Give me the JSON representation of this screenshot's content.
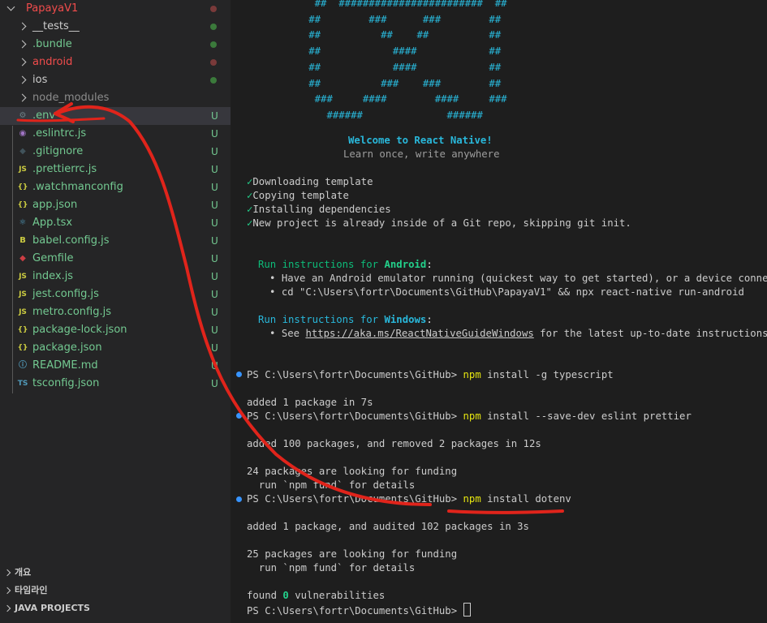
{
  "explorer": {
    "root": {
      "label": "PapayaV1",
      "color": "#f14c4c",
      "dot": "#7a3a3a"
    },
    "folders": [
      {
        "label": "__tests__",
        "color": "#cccccc",
        "dot": "#3b7a3b"
      },
      {
        "label": ".bundle",
        "color": "#73c991",
        "dot": "#3b7a3b"
      },
      {
        "label": "android",
        "color": "#f14c4c",
        "dot": "#7a3a3a"
      },
      {
        "label": "ios",
        "color": "#cccccc",
        "dot": "#3b7a3b"
      },
      {
        "label": "node_modules",
        "color": "#8c8c8c",
        "dot": ""
      }
    ],
    "files": [
      {
        "label": ".env",
        "icon": "gear-icon",
        "glyph": "⚙",
        "icon_color": "#6d8086",
        "status": "U",
        "selected": true
      },
      {
        "label": ".eslintrc.js",
        "icon": "eslint-icon",
        "glyph": "◉",
        "icon_color": "#a074c4",
        "status": "U"
      },
      {
        "label": ".gitignore",
        "icon": "git-icon",
        "glyph": "◆",
        "icon_color": "#41535b",
        "status": "U"
      },
      {
        "label": ".prettierrc.js",
        "icon": "js-icon",
        "glyph": "JS",
        "icon_color": "#cbcb41",
        "status": "U"
      },
      {
        "label": ".watchmanconfig",
        "icon": "json-icon",
        "glyph": "{}",
        "icon_color": "#cbcb41",
        "status": "U"
      },
      {
        "label": "app.json",
        "icon": "json-icon",
        "glyph": "{}",
        "icon_color": "#cbcb41",
        "status": "U"
      },
      {
        "label": "App.tsx",
        "icon": "react-icon",
        "glyph": "⚛",
        "icon_color": "#519aba",
        "status": "U"
      },
      {
        "label": "babel.config.js",
        "icon": "babel-icon",
        "glyph": "B",
        "icon_color": "#cbcb41",
        "status": "U"
      },
      {
        "label": "Gemfile",
        "icon": "ruby-icon",
        "glyph": "◆",
        "icon_color": "#cc3e44",
        "status": "U"
      },
      {
        "label": "index.js",
        "icon": "js-icon",
        "glyph": "JS",
        "icon_color": "#cbcb41",
        "status": "U"
      },
      {
        "label": "jest.config.js",
        "icon": "js-icon",
        "glyph": "JS",
        "icon_color": "#cbcb41",
        "status": "U"
      },
      {
        "label": "metro.config.js",
        "icon": "js-icon",
        "glyph": "JS",
        "icon_color": "#cbcb41",
        "status": "U"
      },
      {
        "label": "package-lock.json",
        "icon": "json-icon",
        "glyph": "{}",
        "icon_color": "#cbcb41",
        "status": "U"
      },
      {
        "label": "package.json",
        "icon": "json-icon",
        "glyph": "{}",
        "icon_color": "#cbcb41",
        "status": "U"
      },
      {
        "label": "README.md",
        "icon": "info-icon",
        "glyph": "ⓘ",
        "icon_color": "#519aba",
        "status": "U"
      },
      {
        "label": "tsconfig.json",
        "icon": "ts-icon",
        "glyph": "TS",
        "icon_color": "#519aba",
        "status": "U"
      }
    ],
    "sections": [
      {
        "label": "개요"
      },
      {
        "label": "타임라인"
      },
      {
        "label": "JAVA PROJECTS"
      }
    ]
  },
  "terminal": {
    "ascii_logo": [
      "              ##  ########################  ##",
      "             ##        ###      ###        ##",
      "             ##          ##    ##          ##",
      "             ##            ####            ##",
      "             ##            ####            ##",
      "             ##          ###    ###        ##",
      "              ###     ####        ####     ###",
      "                ######              ######"
    ],
    "welcome": "Welcome to React Native!",
    "tagline": "Learn once, write anywhere",
    "steps": [
      "Downloading template",
      "Copying template",
      "Installing dependencies",
      "New project is already inside of a Git repo, skipping git init."
    ],
    "android": {
      "prefix": "Run instructions for ",
      "platform": "Android",
      "suffix": ":",
      "bullets": [
        "Have an Android emulator running (quickest way to get started), or a device connected.",
        "cd \"C:\\Users\\fortr\\Documents\\GitHub\\PapayaV1\" && npx react-native run-android"
      ]
    },
    "windows": {
      "prefix": "Run instructions for ",
      "platform": "Windows",
      "suffix": ":",
      "bullet_pre": "See ",
      "link": "https://aka.ms/ReactNativeGuideWindows",
      "bullet_post": " for the latest up-to-date instructions."
    },
    "prompt": "PS C:\\Users\\fortr\\Documents\\GitHub>",
    "commands": [
      {
        "bin": "npm",
        "args": " install -g typescript"
      },
      {
        "bin": "npm",
        "args": " install --save-dev eslint prettier"
      },
      {
        "bin": "npm",
        "args": " install dotenv"
      }
    ],
    "out1": "added 1 package in 7s",
    "out2": "added 100 packages, and removed 2 packages in 12s",
    "fund1a": "24 packages are looking for funding",
    "fund_b": "  run `npm fund` for details",
    "out3": "added 1 package, and audited 102 packages in 3s",
    "fund2a": "25 packages are looking for funding",
    "vuln_pre": "found ",
    "vuln_num": "0",
    "vuln_post": " vulnerabilities"
  }
}
